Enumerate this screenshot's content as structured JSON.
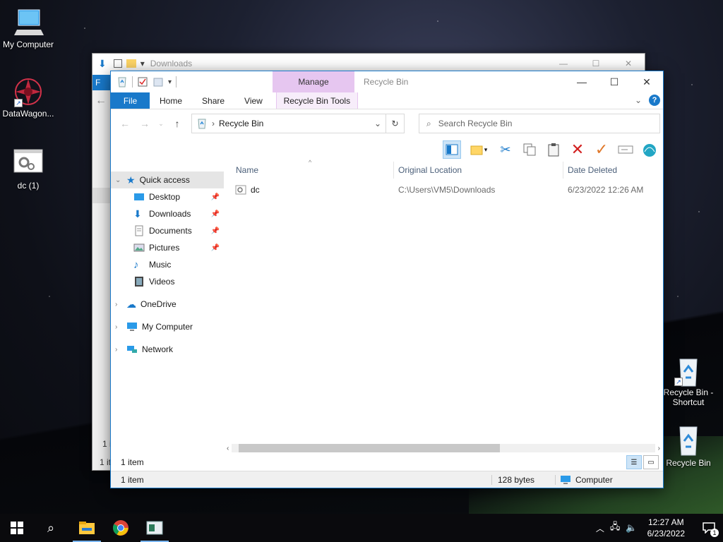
{
  "desktop": {
    "icons": [
      {
        "label": "My Computer"
      },
      {
        "label": "DataWagon..."
      },
      {
        "label": "dc (1)"
      },
      {
        "label": "Recycle Bin - Shortcut"
      },
      {
        "label": "Recycle Bin"
      }
    ]
  },
  "back_window": {
    "title": "Downloads",
    "tab_letter": "F",
    "status_count": "1 i",
    "status_items": "1 ite"
  },
  "window": {
    "title": "Recycle Bin",
    "context_tab": "Manage",
    "tabs": {
      "file": "File",
      "home": "Home",
      "share": "Share",
      "view": "View",
      "tools": "Recycle Bin Tools"
    },
    "address": "Recycle Bin",
    "search_placeholder": "Search Recycle Bin",
    "nav": {
      "quick_access": "Quick access",
      "desktop": "Desktop",
      "downloads": "Downloads",
      "documents": "Documents",
      "pictures": "Pictures",
      "music": "Music",
      "videos": "Videos",
      "onedrive": "OneDrive",
      "my_computer": "My Computer",
      "network": "Network"
    },
    "columns": {
      "name": "Name",
      "location": "Original Location",
      "deleted": "Date Deleted"
    },
    "files": [
      {
        "name": "dc",
        "location": "C:\\Users\\VM5\\Downloads",
        "deleted": "6/23/2022 12:26 AM"
      }
    ],
    "inner_status": "1 item",
    "status": {
      "items": "1 item",
      "size": "128 bytes",
      "location": "Computer"
    }
  },
  "taskbar": {
    "time": "12:27 AM",
    "date": "6/23/2022",
    "notif_count": "1"
  }
}
